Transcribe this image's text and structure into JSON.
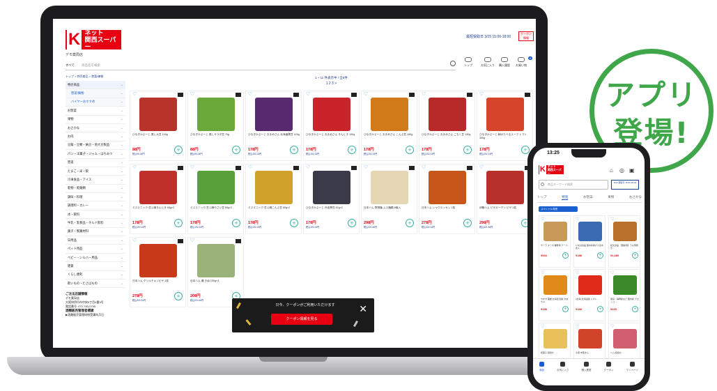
{
  "site": {
    "logo_mark": "K",
    "logo_text_1": "ネット",
    "logo_text_2": "関西スーパー",
    "store_name": "デモ薬局店",
    "delivery_label": "最短受取日 3/25 15:00-18:00",
    "coupon_badge": "クーポン 情報",
    "search_category": "すべて",
    "search_placeholder": "商品名を検索",
    "nav": [
      {
        "label": "トップ"
      },
      {
        "label": "お気に入り"
      },
      {
        "label": "購入履歴"
      },
      {
        "label": "お買い物"
      }
    ],
    "cart_count": "0",
    "breadcrumb": "トップ > 特売商品 > 惣菜/練物",
    "pager_text": "1 ~ 11 件表示中 / 全6件",
    "pager_pages": "1 2 3 >"
  },
  "sidebar": {
    "items": [
      {
        "label": "特売商品",
        "state": "active"
      },
      {
        "label": "惣菜/練物",
        "state": "sub"
      },
      {
        "label": "バイヤーおすすめ",
        "state": "sub"
      },
      {
        "label": "お惣菜",
        "state": ""
      },
      {
        "label": "果物",
        "state": ""
      },
      {
        "label": "おさかな",
        "state": ""
      },
      {
        "label": "お肉",
        "state": ""
      },
      {
        "label": "豆腐・豆類・納豆・他大豆製品",
        "state": ""
      },
      {
        "label": "パン・洋菓子・ジャム・はちみつ",
        "state": ""
      },
      {
        "label": "惣菜",
        "state": ""
      },
      {
        "label": "たまご・米・飲",
        "state": ""
      },
      {
        "label": "冷凍食品・アイス",
        "state": ""
      },
      {
        "label": "乾物・乾麺類",
        "state": ""
      },
      {
        "label": "調味・料理",
        "state": ""
      },
      {
        "label": "調理料・カレー",
        "state": ""
      },
      {
        "label": "水・飲料",
        "state": ""
      },
      {
        "label": "牛乳・乳製品・チルド飲料",
        "state": ""
      },
      {
        "label": "菓子・製菓材料",
        "state": ""
      },
      {
        "label": "日用品",
        "state": ""
      },
      {
        "label": "ペット用品",
        "state": ""
      },
      {
        "label": "ベビー・シルバー用品",
        "state": ""
      },
      {
        "label": "雑貨",
        "state": ""
      },
      {
        "label": "くらし便利",
        "state": ""
      },
      {
        "label": "飲いもの・たさばもの",
        "state": ""
      }
    ],
    "info_title": "ご注法店舗情報",
    "info_lines": [
      "デモ薬局店",
      "大阪府伊丹市中央5丁目4番3号",
      "電話番号: 072-783-0755"
    ],
    "info_title_2": "酒類販売管理者標識",
    "info_line_2": "▶酒類販売管理研修受講年月日"
  },
  "products": [
    {
      "name": "ひなぎかぷーじ 蒸し大豆 100g",
      "price": "88円",
      "tax": "税込95.04円",
      "color": "#b8332a"
    },
    {
      "name": "ひなぎかぷーじ 蒸しサラダ豆 70g",
      "price": "88円",
      "tax": "税込95.04円",
      "color": "#6aa83a"
    },
    {
      "name": "ひなぎかぷーじ おまめさん 北海道黒豆 115g",
      "price": "178円",
      "tax": "税込192.24円",
      "color": "#5a2a70"
    },
    {
      "name": "ひなぎかぷーじ おまめさん きんとき 130g",
      "price": "178円",
      "tax": "税込192.24円",
      "color": "#c8242a"
    },
    {
      "name": "ひなぎかぷーじ おまめさん こんぶ豆 150g",
      "price": "178円",
      "tax": "税込192.24円",
      "color": "#d07a1a"
    },
    {
      "name": "ひなぎかぷーじ おまめさん ごもく豆 130g",
      "price": "178円",
      "tax": "税込192.24円",
      "color": "#b82a2a"
    },
    {
      "name": "ひなぎかぷーじ 朝のたべるスープ トマト 350g",
      "price": "178円",
      "tax": "税込192.24円",
      "color": "#d6442a"
    },
    {
      "name": "ミスミニック 豆ふ鍋きんとき 65g×2",
      "price": "178円",
      "tax": "税込192.24円",
      "color": "#c0302a"
    },
    {
      "name": "ミスミニック 豆ふ鍋やさい豆 65g×2",
      "price": "178円",
      "tax": "税込192.24円",
      "color": "#5aa03a"
    },
    {
      "name": "ミスミニック 豆ふ鍋こんぶ豆 65g×2",
      "price": "178円",
      "tax": "税込192.24円",
      "color": "#d0a22a"
    },
    {
      "name": "ひなぎかぷーじ 丹波黒豆 62g×2",
      "price": "178円",
      "tax": "税込192.24円",
      "color": "#3a3a48"
    },
    {
      "name": "日本ハム 冥想麺 ムス麺類 8個入",
      "price": "298円",
      "tax": "税込321.84円",
      "color": "#e6d7b4"
    },
    {
      "name": "日本ハム シャウエッセン 1枚",
      "price": "278円",
      "tax": "税込300.24円",
      "color": "#c8551a"
    },
    {
      "name": "伊藤ハム ピザガーデン ピザ 1枚",
      "price": "298円",
      "tax": "税込321.84円",
      "color": "#b8302a"
    },
    {
      "name": "日本ハム グリルチキンピザ 1枚",
      "price": "278円",
      "tax": "税込300.24円",
      "color": "#c83a1a"
    },
    {
      "name": "日本ハム 瀬 きぬ 150g×3",
      "price": "208円",
      "tax": "税込224.64円",
      "color": "#9ab37a"
    }
  ],
  "coupon_banner": {
    "text": "只今、クーポンがご利用いただけます",
    "button": "クーポン情報を見る",
    "close": "✕"
  },
  "phone": {
    "time": "13:25",
    "logo_mark": "K",
    "logo_text_1": "ネット",
    "logo_text_2": "関西スーパー",
    "search_placeholder": "商品キーワード検索",
    "badge_text": "3/23 受取可 15:00-18:00",
    "tabs": [
      "トップ",
      "特売",
      "お惣菜",
      "果物",
      "おさかな"
    ],
    "active_tab": "特売",
    "category_chip": "スペシャル特売",
    "items": [
      {
        "name": "サーラ ヌーボ 業務用 ケース…",
        "price": "¥534",
        "color": "#c89a5a"
      },
      {
        "name": "いなば食品 国内水揚げさば水煮 1…",
        "price": "¥188",
        "color": "#3a6ab0"
      },
      {
        "name": "紀文食品 【国産焼】うな蒲焼き…",
        "price": "¥2,280",
        "color": "#b8702a"
      },
      {
        "name": "やまや 蓮根 北海道 国産 かぼちゃ…",
        "price": "¥198",
        "color": "#e08a1a"
      },
      {
        "name": "(北海) 北海道産 トマト…",
        "price": "¥168",
        "color": "#e02a1a"
      },
      {
        "name": "徳島・静岡産など 国内産 ブロッコ…",
        "price": "¥229",
        "color": "#3a8a2a"
      },
      {
        "name": "和菓子 詰合せ…",
        "price": "¥298",
        "color": "#e8c05a"
      },
      {
        "name": "冷凍 中華まん…",
        "price": "¥258",
        "color": "#d0442a"
      },
      {
        "name": "ハム 詰合せ…",
        "price": "¥398",
        "color": "#d06070"
      }
    ],
    "nav": [
      {
        "label": "商品"
      },
      {
        "label": "お気に入り"
      },
      {
        "label": "購入履歴"
      },
      {
        "label": "クーポン"
      },
      {
        "label": "マイページ"
      }
    ]
  },
  "app_badge": {
    "line1": "アプリ",
    "line2": "登場!"
  },
  "colors": {
    "brand_red": "#e60012",
    "accent_blue": "#1a5fd0",
    "badge_green": "#3fa64a"
  }
}
